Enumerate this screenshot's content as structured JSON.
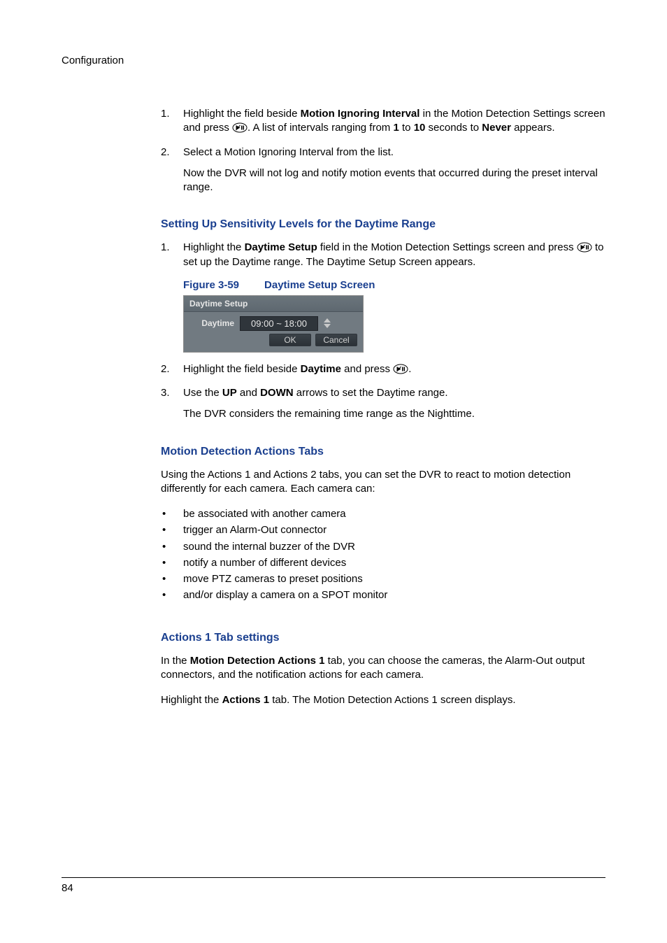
{
  "running_header": "Configuration",
  "step1": {
    "num": "1.",
    "line1a": "Highlight the field beside ",
    "line1b": "Motion Ignoring Interval",
    "line1c": " in the Motion Detection Settings screen and press ",
    "line1d": ". A list of intervals ranging from ",
    "one": "1",
    "line1e": " to ",
    "ten": "10",
    "line1f": " seconds to ",
    "never": "Never",
    "line1g": " appears."
  },
  "step2": {
    "num": "2.",
    "line": "Select a Motion Ignoring Interval from the list.",
    "sub": "Now the DVR will not log and notify motion events that occurred during the preset interval range."
  },
  "heading_sensitivity": "Setting Up Sensitivity Levels for the Daytime Range",
  "sens_step1": {
    "num": "1.",
    "a": "Highlight the ",
    "b": "Daytime Setup",
    "c": " field in the Motion Detection Settings screen and press ",
    "d": " to set up the Daytime range. The Daytime Setup Screen appears."
  },
  "figure": {
    "label": "Figure 3-59",
    "title": "Daytime Setup Screen",
    "box_title": "Daytime Setup",
    "row_label": "Daytime",
    "row_value": "09:00 ~ 18:00",
    "ok": "OK",
    "cancel": "Cancel"
  },
  "sens_step2": {
    "num": "2.",
    "a": "Highlight the field beside ",
    "b": "Daytime",
    "c": " and press ",
    "d": "."
  },
  "sens_step3": {
    "num": "3.",
    "a": "Use the ",
    "b": "UP",
    "c": " and ",
    "d": "DOWN",
    "e": " arrows to set the Daytime range.",
    "sub": "The DVR considers the remaining time range as the Nighttime."
  },
  "heading_motion_actions": "Motion Detection Actions Tabs",
  "motion_para": "Using the Actions 1 and Actions 2 tabs, you can set the DVR to react to motion detection differently for each camera. Each camera can:",
  "bullets": [
    "be associated with another camera",
    "trigger an Alarm-Out connector",
    "sound the internal buzzer of the DVR",
    "notify a number of different devices",
    "move PTZ cameras to preset positions",
    "and/or display a camera on a SPOT monitor"
  ],
  "heading_actions1": "Actions 1 Tab settings",
  "actions1_para_a": "In the ",
  "actions1_para_b": "Motion Detection Actions 1",
  "actions1_para_c": " tab, you can choose the cameras, the Alarm-Out output connectors, and the notification actions for each camera.",
  "actions1_para2_a": "Highlight the ",
  "actions1_para2_b": "Actions 1",
  "actions1_para2_c": " tab. The Motion Detection Actions 1 screen displays.",
  "page_number": "84"
}
